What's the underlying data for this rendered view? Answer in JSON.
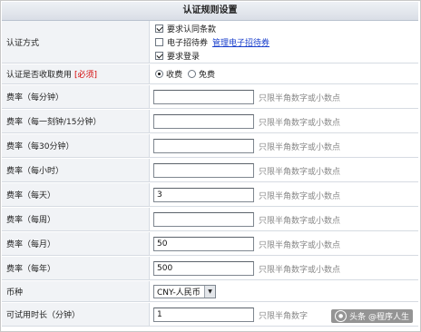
{
  "title": "认证规则设置",
  "auth_method": {
    "label": "认证方式",
    "options": [
      {
        "label": "要求认同条款",
        "checked": true
      },
      {
        "label": "电子招待券",
        "checked": false,
        "link": "管理电子招待券"
      },
      {
        "label": "要求登录",
        "checked": true
      }
    ]
  },
  "fee_required": {
    "label": "认证是否收取费用",
    "required_tag": "[必须]",
    "options": [
      {
        "label": "收费",
        "checked": true
      },
      {
        "label": "免费",
        "checked": false
      }
    ]
  },
  "rates": [
    {
      "label": "费率（每分钟）",
      "value": "",
      "hint": "只限半角数字或小数点"
    },
    {
      "label": "费率（每一刻钟/15分钟）",
      "value": "",
      "hint": "只限半角数字或小数点"
    },
    {
      "label": "费率（每30分钟）",
      "value": "",
      "hint": "只限半角数字或小数点"
    },
    {
      "label": "费率（每小时）",
      "value": "",
      "hint": "只限半角数字或小数点"
    },
    {
      "label": "费率（每天）",
      "value": "3",
      "hint": "只限半角数字或小数点"
    },
    {
      "label": "费率（每周）",
      "value": "",
      "hint": "只限半角数字或小数点"
    },
    {
      "label": "费率（每月）",
      "value": "50",
      "hint": "只限半角数字或小数点"
    },
    {
      "label": "费率（每年）",
      "value": "500",
      "hint": "只限半角数字或小数点"
    }
  ],
  "currency": {
    "label": "币种",
    "value": "CNY-人民币"
  },
  "trial": {
    "label": "可试用时长（分钟）",
    "value": "1",
    "hint": "只限半角数字"
  },
  "watermark": "头条 @程序人生"
}
